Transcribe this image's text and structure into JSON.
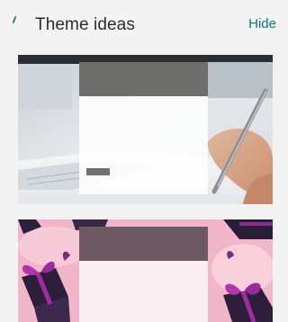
{
  "header": {
    "title": "Theme ideas",
    "hide_label": "Hide"
  },
  "themes": [
    {
      "name": "writing-desk-theme",
      "accent": "#6e6e6c"
    },
    {
      "name": "gift-boxes-theme",
      "accent": "#6e5a62"
    }
  ],
  "colors": {
    "link": "#11766f",
    "background": "#f3f3f3"
  }
}
